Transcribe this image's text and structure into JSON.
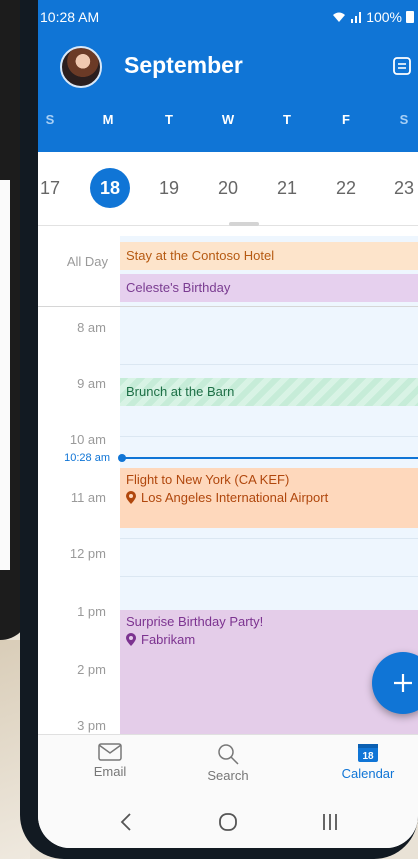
{
  "status_bar": {
    "time": "10:28 AM",
    "battery": "100%"
  },
  "header": {
    "title": "September",
    "weekdays": [
      "S",
      "M",
      "T",
      "W",
      "T",
      "F",
      "S"
    ]
  },
  "date_strip": {
    "dates": [
      "17",
      "18",
      "19",
      "20",
      "21",
      "22",
      "23"
    ],
    "selected": "18"
  },
  "schedule": {
    "all_day_label": "All Day",
    "hours": [
      "8 am",
      "9 am",
      "10 am",
      "11 am",
      "12 pm",
      "1 pm",
      "2 pm",
      "3 pm"
    ],
    "now_label": "10:28 am",
    "events": {
      "hotel": {
        "title": "Stay at the Contoso Hotel"
      },
      "birthday": {
        "title": "Celeste's Birthday"
      },
      "brunch": {
        "title": "Brunch at the Barn"
      },
      "flight": {
        "title": "Flight to New York (CA KEF)",
        "location": "Los Angeles International Airport"
      },
      "party": {
        "title": "Surprise Birthday Party!",
        "location": "Fabrikam"
      }
    }
  },
  "tabs": {
    "email": "Email",
    "search": "Search",
    "calendar": "Calendar",
    "calendar_badge": "18"
  },
  "colors": {
    "accent": "#1075d6",
    "hotel": "#fde4cb",
    "birthday": "#e6d0ee",
    "brunch": "#c6ecd8",
    "flight": "#fed8bc",
    "party": "#e4cde9"
  }
}
